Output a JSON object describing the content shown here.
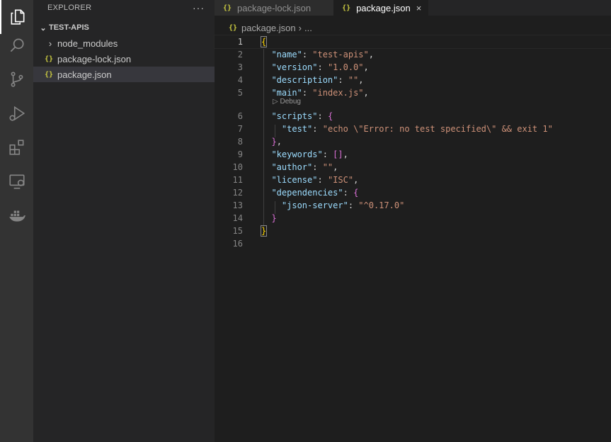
{
  "activity_bar": {
    "items": [
      {
        "name": "explorer-icon",
        "active": true
      },
      {
        "name": "search-icon"
      },
      {
        "name": "source-control-icon"
      },
      {
        "name": "run-debug-icon"
      },
      {
        "name": "extensions-icon"
      },
      {
        "name": "remote-explorer-icon"
      },
      {
        "name": "docker-icon"
      }
    ]
  },
  "sidebar": {
    "title": "EXPLORER",
    "more": "···",
    "folder": "TEST-APIS",
    "items": [
      {
        "label": "node_modules",
        "type": "folder"
      },
      {
        "label": "package-lock.json",
        "type": "json"
      },
      {
        "label": "package.json",
        "type": "json",
        "selected": true
      }
    ]
  },
  "tabs": [
    {
      "label": "package-lock.json",
      "active": false
    },
    {
      "label": "package.json",
      "active": true,
      "close": "×"
    }
  ],
  "breadcrumb": {
    "file": "package.json",
    "sep": "›",
    "rest": "..."
  },
  "editor": {
    "codelens": "▷ Debug",
    "line_numbers": [
      "1",
      "2",
      "3",
      "4",
      "5",
      "6",
      "7",
      "8",
      "9",
      "10",
      "11",
      "12",
      "13",
      "14",
      "15",
      "16"
    ]
  },
  "colors": {
    "accent_json": "#cbcb41",
    "key": "#9cdcfe",
    "string": "#ce9178"
  }
}
